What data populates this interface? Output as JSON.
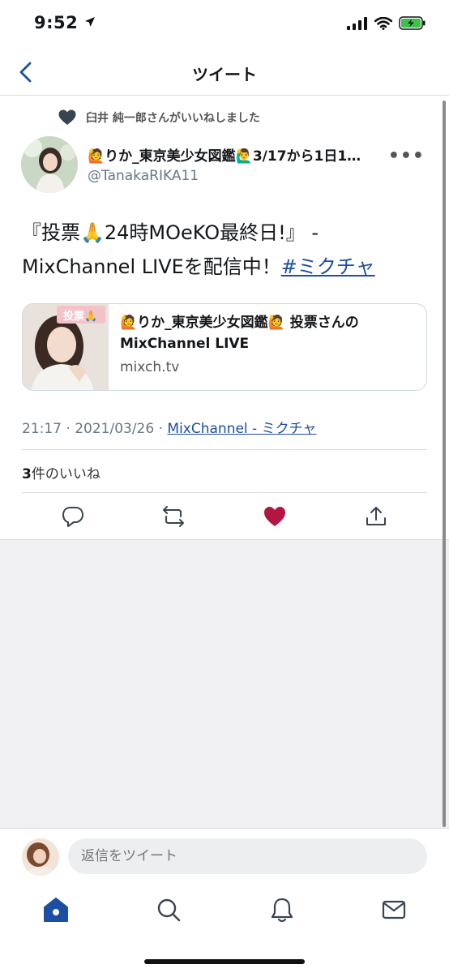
{
  "status": {
    "time": "9:52"
  },
  "header": {
    "title": "ツイート"
  },
  "tweet": {
    "liked_by": "臼井 純一郎さんがいいねしました",
    "author_name": "🙋りか_東京美少女図鑑🙋‍♂️3/17から1日1…",
    "author_handle": "@TanakaRIKA11",
    "text_line1": "『投票🙏24時MOeKO最終日!』 -",
    "text_line2": "MixChannel LIVEを配信中！",
    "hashtag": "#ミクチャ",
    "card": {
      "thumb_badge": "投票🙏",
      "title": "🙋りか_東京美少女図鑑🙋 投票さんの MixChannel LIVE",
      "domain": "mixch.tv"
    },
    "meta_time": "21:17 · 2021/03/26 · ",
    "meta_source": "MixChannel - ミクチャ",
    "likes_count": "3",
    "likes_label": "件のいいね"
  },
  "reply": {
    "placeholder": "返信をツイート"
  },
  "colors": {
    "accent": "#1c4fa0",
    "like": "#b3163f",
    "tab_active": "#1c4fa0"
  },
  "icons": [
    "back-chevron-icon",
    "heart-icon",
    "more-icon",
    "reply-icon",
    "retweet-icon",
    "like-icon",
    "share-icon",
    "home-icon",
    "search-icon",
    "notifications-icon",
    "messages-icon"
  ]
}
